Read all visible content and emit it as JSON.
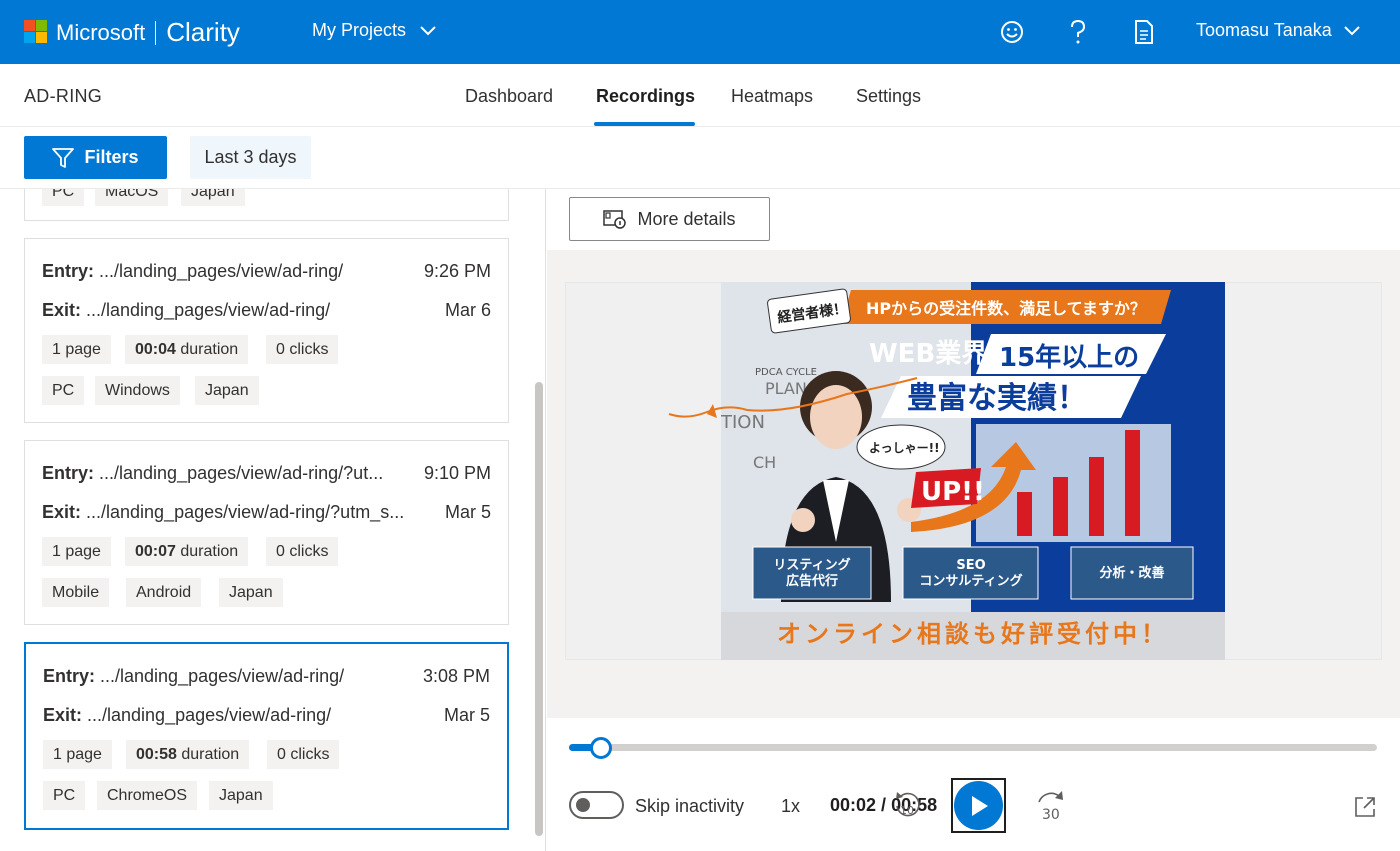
{
  "app": {
    "brand": "Microsoft",
    "product": "Clarity",
    "project_menu": "My Projects",
    "user_name": "Toomasu Tanaka",
    "colors": {
      "accent": "#0078d4",
      "logo": [
        "#f25022",
        "#7fba00",
        "#00a4ef",
        "#ffb900"
      ]
    }
  },
  "project": {
    "name": "AD-RING"
  },
  "tabs": [
    {
      "label": "Dashboard",
      "active": false
    },
    {
      "label": "Recordings",
      "active": true
    },
    {
      "label": "Heatmaps",
      "active": false
    },
    {
      "label": "Settings",
      "active": false
    }
  ],
  "filterbar": {
    "filters_label": "Filters",
    "range_label": "Last 3 days"
  },
  "sessions": [
    {
      "entry_label": "Entry:",
      "entry": ".../landing_pages/view/ad-ring/",
      "time": "9:26 PM",
      "exit_label": "Exit:",
      "exit": ".../landing_pages/view/ad-ring/",
      "date": "Mar 6",
      "pages": "1 page",
      "duration_value": "00:04",
      "duration_unit": "duration",
      "clicks": "0 clicks",
      "device": "PC",
      "os": "Windows",
      "country": "Japan",
      "selected": false
    },
    {
      "entry_label": "Entry:",
      "entry": ".../landing_pages/view/ad-ring/?ut...",
      "time": "9:10 PM",
      "exit_label": "Exit:",
      "exit": ".../landing_pages/view/ad-ring/?utm_s...",
      "date": "Mar 5",
      "pages": "1 page",
      "duration_value": "00:07",
      "duration_unit": "duration",
      "clicks": "0 clicks",
      "device": "Mobile",
      "os": "Android",
      "country": "Japan",
      "selected": false
    },
    {
      "entry_label": "Entry:",
      "entry": ".../landing_pages/view/ad-ring/",
      "time": "3:08 PM",
      "exit_label": "Exit:",
      "exit": ".../landing_pages/view/ad-ring/",
      "date": "Mar 5",
      "pages": "1 page",
      "duration_value": "00:58",
      "duration_unit": "duration",
      "clicks": "0 clicks",
      "device": "PC",
      "os": "ChromeOS",
      "country": "Japan",
      "selected": true
    }
  ],
  "partial_card": {
    "device": "PC",
    "os": "MacOS",
    "country": "Japan"
  },
  "player": {
    "more_details": "More details",
    "skip_inactivity": "Skip inactivity",
    "speed": "1x",
    "current_time": "00:02",
    "total_time": "00:58",
    "time_separator": " / ",
    "progress": 0.04,
    "back_seconds": "10",
    "forward_seconds": "30"
  },
  "banner": {
    "badge": "経営者様！",
    "headline": "HPからの受注件数、満足してますか？",
    "line1_a": "WEB業界",
    "line1_b": "15年以上の",
    "line2": "豊富な実績！",
    "shout": "よっしゃー!!",
    "up": "UP!!",
    "bg_1": "PDCA CYCLE",
    "bg_2": "PLAN",
    "bg_3": "TION",
    "bg_4": "CH",
    "services": [
      "リスティング\n広告代行",
      "SEO\nコンサルティング",
      "分析・改善"
    ],
    "footer": "オンライン相談も好評受付中！"
  }
}
